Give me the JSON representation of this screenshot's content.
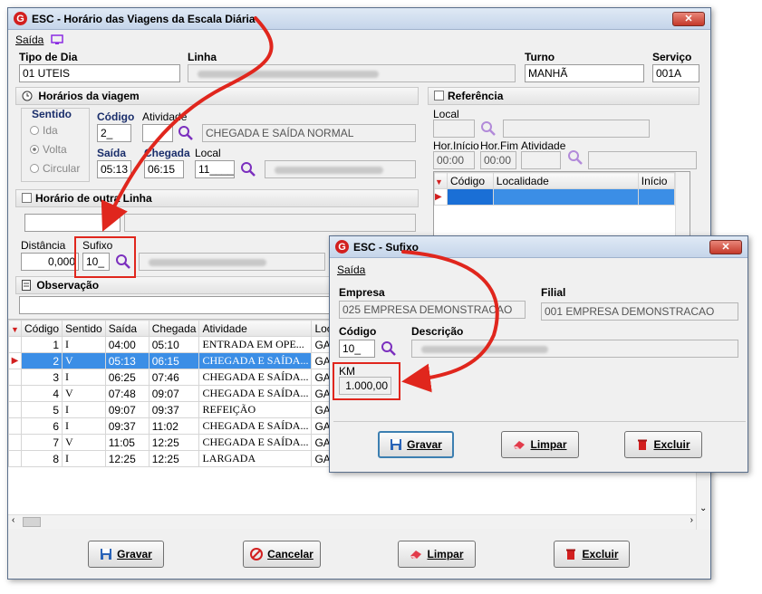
{
  "main": {
    "title": "ESC - Horário das Viagens da Escala Diária",
    "close": "✕",
    "menu": "Saída",
    "tipo_dia": {
      "label": "Tipo de Dia",
      "value": "01 UTEIS"
    },
    "linha": {
      "label": "Linha"
    },
    "turno": {
      "label": "Turno",
      "value": "MANHÃ"
    },
    "servico": {
      "label": "Serviço",
      "value": "001A"
    },
    "horarios": {
      "title": "Horários da viagem",
      "sentido_label": "Sentido",
      "radios": [
        "Ida",
        "Volta",
        "Circular"
      ],
      "codigo_label": "Código",
      "codigo_value": "2_",
      "atividade_label": "Atividade",
      "atividade_desc": "CHEGADA E SAÍDA NORMAL",
      "saida_label": "Saída",
      "saida_value": "05:13",
      "chegada_label": "Chegada",
      "chegada_value": "06:15",
      "local_label": "Local",
      "local_value": "11____"
    },
    "outra_linha": {
      "title": "Horário de outra Linha"
    },
    "distancia": {
      "label": "Distância",
      "value": "0,000"
    },
    "sufixo": {
      "label": "Sufixo",
      "value": "10_"
    },
    "observacao": {
      "title": "Observação"
    },
    "referencia": {
      "title": "Referência",
      "local_label": "Local",
      "hor_inicio": "Hor.Início",
      "hor_fim": "Hor.Fim",
      "atividade": "Atividade",
      "hor_inicio_value": "00:00",
      "hor_fim_value": "00:00",
      "cols": [
        "Código",
        "Localidade",
        "Início"
      ]
    },
    "grid": {
      "cols": [
        "Código",
        "Sentido",
        "Saída",
        "Chegada",
        "Atividade",
        "Local"
      ],
      "rows": [
        [
          "1",
          "I",
          "04:00",
          "05:10",
          "ENTRADA EM OPE...",
          "GARAGE"
        ],
        [
          "2",
          "V",
          "05:13",
          "06:15",
          "CHEGADA E SAÍDA...",
          "GARAGE"
        ],
        [
          "3",
          "I",
          "06:25",
          "07:46",
          "CHEGADA E SAÍDA...",
          "GARAGE"
        ],
        [
          "4",
          "V",
          "07:48",
          "09:07",
          "CHEGADA E SAÍDA...",
          "GARAGE"
        ],
        [
          "5",
          "I",
          "09:07",
          "09:37",
          "REFEIÇÃO",
          "GARAGE"
        ],
        [
          "6",
          "I",
          "09:37",
          "11:02",
          "CHEGADA E SAÍDA...",
          "GARAGE"
        ],
        [
          "7",
          "V",
          "11:05",
          "12:25",
          "CHEGADA E SAÍDA...",
          "GARAGE"
        ],
        [
          "8",
          "I",
          "12:25",
          "12:25",
          "LARGADA",
          "GARAGE"
        ]
      ]
    },
    "buttons": {
      "gravar": "Gravar",
      "cancelar": "Cancelar",
      "limpar": "Limpar",
      "excluir": "Excluir"
    }
  },
  "dialog": {
    "title": "ESC - Sufixo",
    "close": "✕",
    "menu": "Saída",
    "empresa": {
      "label": "Empresa",
      "value": "025 EMPRESA DEMONSTRACAO"
    },
    "filial": {
      "label": "Filial",
      "value": "001 EMPRESA DEMONSTRACAO"
    },
    "codigo": {
      "label": "Código",
      "value": "10_"
    },
    "descricao": {
      "label": "Descrição"
    },
    "km": {
      "label": "KM",
      "value": "1.000,00"
    },
    "buttons": {
      "gravar": "Gravar",
      "limpar": "Limpar",
      "excluir": "Excluir"
    }
  },
  "colors": {
    "highlight": "#e0261d",
    "selection": "#3b8ee6",
    "accent": "#8a2be2"
  }
}
